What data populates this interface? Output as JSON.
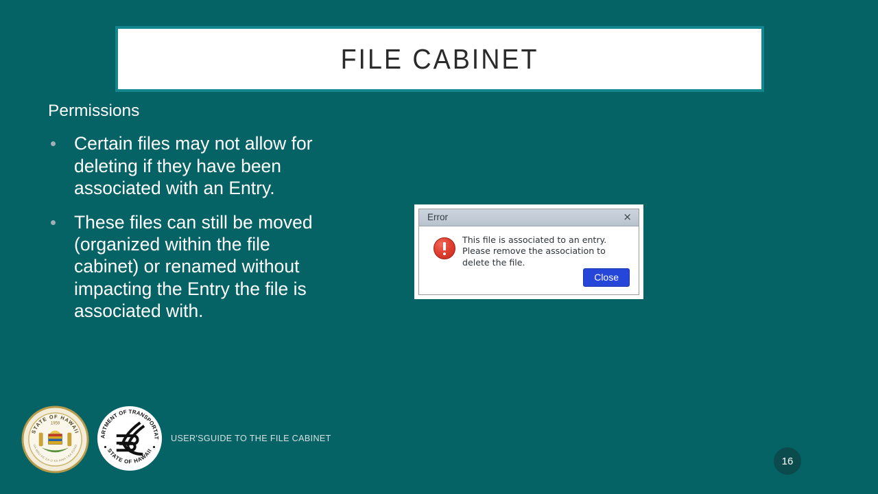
{
  "slide": {
    "title": "FILE CABINET",
    "background_color": "#056265",
    "accent_color": "#13878d",
    "lead": "Permissions",
    "bullets": [
      "Certain files may not allow for deleting if they have been associated with an Entry.",
      "These files can still be moved (organized within the file cabinet) or renamed without impacting the Entry the file is associated with."
    ],
    "footer_text": "USER'SGUIDE TO THE FILE CABINET",
    "page_number": "16"
  },
  "dialog": {
    "title": "Error",
    "close_icon": "×",
    "icon": "error-exclamation-icon",
    "message": "This file is associated to an entry. Please remove the association to delete the file.",
    "button_label": "Close",
    "button_color": "#2546d8"
  },
  "logos": {
    "hawaii_seal": {
      "top_text": "STATE OF HAWAII",
      "year": "1959",
      "bottom_text": "UA MAU KE EA O KA AINA I KA PONO"
    },
    "dot_seal": {
      "top_text": "DEPARTMENT OF TRANSPORTATION",
      "bottom_text": "STATE OF HAWAII"
    }
  }
}
